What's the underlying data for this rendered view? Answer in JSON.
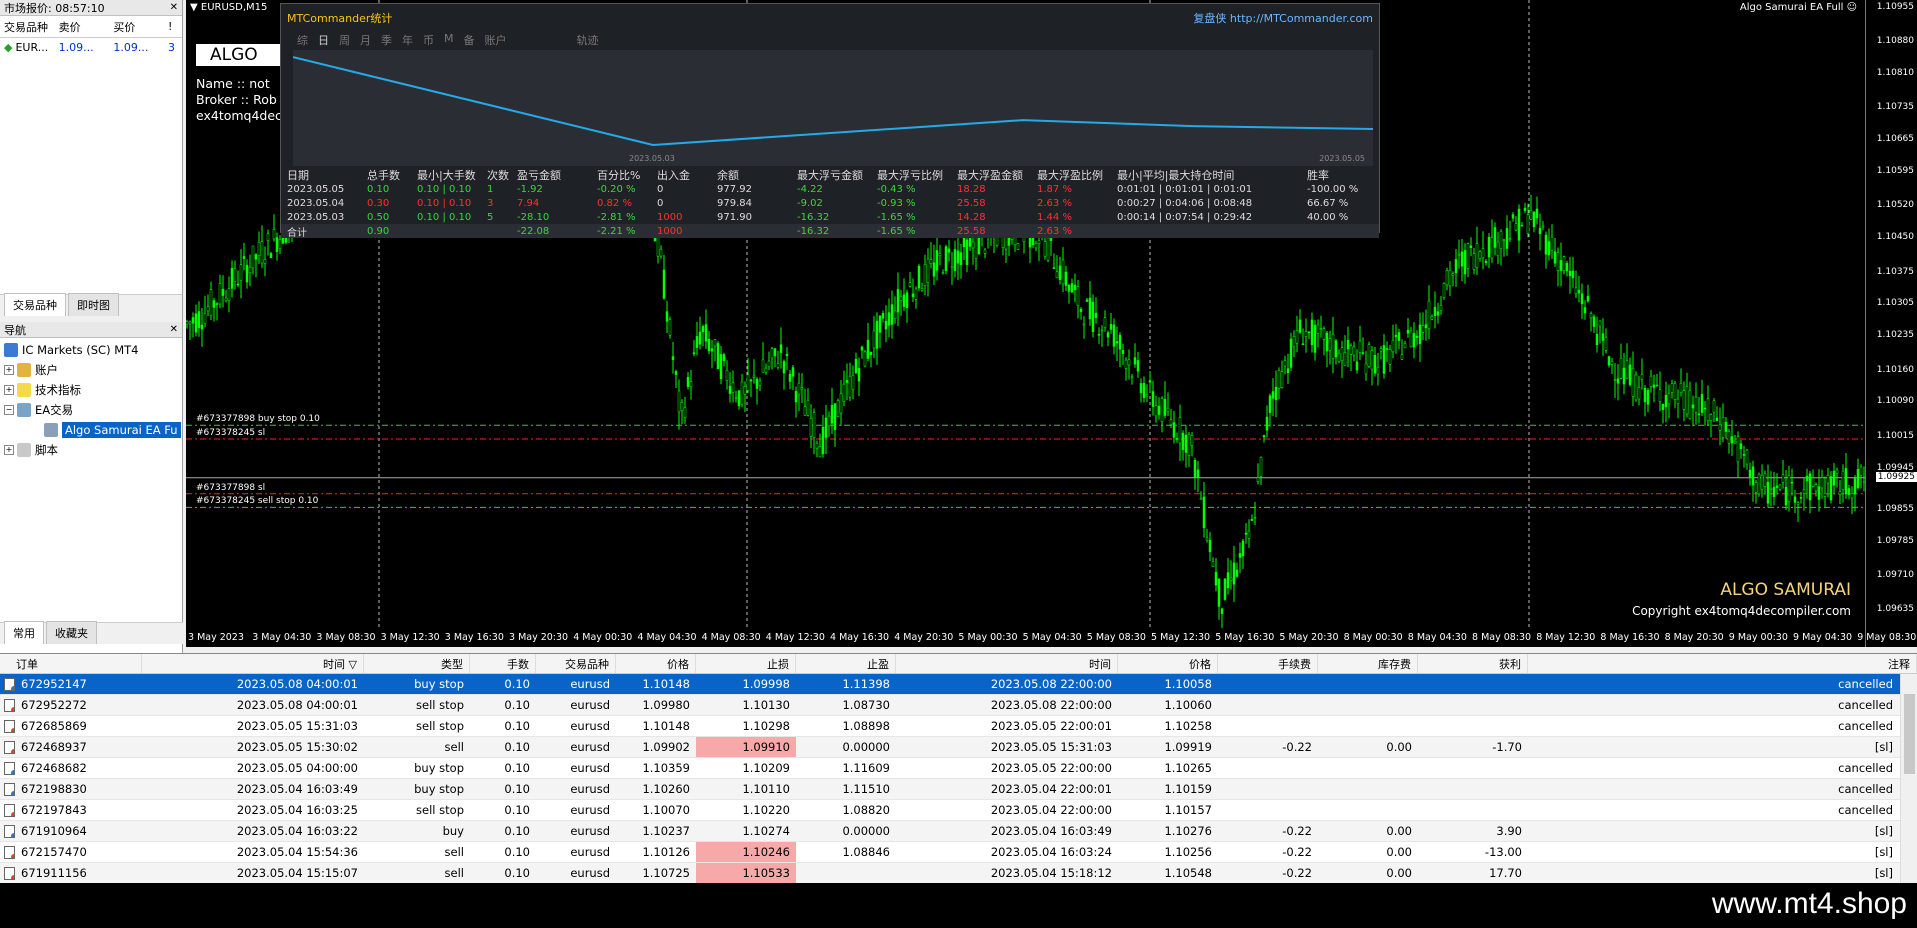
{
  "market_watch": {
    "title": "市场报价: 08:57:10",
    "headers": [
      "交易品种",
      "卖价",
      "买价",
      "!"
    ],
    "rows": [
      {
        "symbol": "EUR...",
        "bid": "1.09...",
        "ask": "1.09...",
        "spread": "3"
      }
    ],
    "tabs": [
      "交易品种",
      "即时图"
    ]
  },
  "navigator": {
    "title": "导航",
    "items": [
      "IC Markets (SC) MT4",
      "账户",
      "技术指标",
      "EA交易",
      "Algo Samurai EA Fu",
      "脚本"
    ],
    "tabs": [
      "常用",
      "收藏夹"
    ]
  },
  "chart": {
    "symbol": "EURUSD,M15",
    "ea_name": "Algo Samurai EA Full",
    "smiley": "☺",
    "algo_box": "ALGO",
    "algo_box_tail": "",
    "info_lines": [
      "Name :: not",
      "Broker :: Rob",
      "ex4tomq4dec"
    ],
    "brand": "ALGO SAMURAI",
    "copyright": "Copyright  ex4tomq4decompiler.com",
    "price_ticks": [
      "1.10955",
      "1.10880",
      "1.10810",
      "1.10735",
      "1.10665",
      "1.10595",
      "1.10520",
      "1.10450",
      "1.10375",
      "1.10305",
      "1.10235",
      "1.10160",
      "1.10090",
      "1.10015",
      "1.09945",
      "1.09855",
      "1.09785",
      "1.09710",
      "1.09635"
    ],
    "current_price": "1.09925",
    "time_ticks": [
      "3 May 2023",
      "3 May 04:30",
      "3 May 08:30",
      "3 May 12:30",
      "3 May 16:30",
      "3 May 20:30",
      "4 May 00:30",
      "4 May 04:30",
      "4 May 08:30",
      "4 May 12:30",
      "4 May 16:30",
      "4 May 20:30",
      "5 May 00:30",
      "5 May 04:30",
      "5 May 08:30",
      "5 May 12:30",
      "5 May 16:30",
      "5 May 20:30",
      "8 May 00:30",
      "8 May 04:30",
      "8 May 08:30",
      "8 May 12:30",
      "8 May 16:30",
      "8 May 20:30",
      "9 May 00:30",
      "9 May 04:30",
      "9 May 08:30"
    ],
    "order_labels": [
      {
        "text": "#673377898 buy stop 0.10",
        "price": 1.1004
      },
      {
        "text": "#673378245 sl",
        "price": 1.1001
      },
      {
        "text": "#673377898 sl",
        "price": 1.0989
      },
      {
        "text": "#673378245 sell stop 0.10",
        "price": 1.0986
      }
    ],
    "colors": {
      "candle": "#00ff00",
      "buy_line": "#33cc33",
      "sl_line": "#ff2020",
      "price_line": "#aaaaaa"
    }
  },
  "mtc": {
    "title": "MTCommander统计",
    "link": "复盘侠 http://MTCommander.com",
    "tabs": [
      "综",
      "日",
      "周",
      "月",
      "季",
      "年",
      "币",
      "M",
      "备",
      "账户",
      "轨迹"
    ],
    "active_tab": "日",
    "date_start": "2023.05.03",
    "date_end": "2023.05.05",
    "headers": [
      "日期",
      "总手数",
      "最小|大手数",
      "次数",
      "盈亏金额",
      "百分比%",
      "出入金",
      "余额",
      "最大浮亏金额",
      "最大浮亏比例",
      "最大浮盈金额",
      "最大浮盈比例",
      "最小|平均|最大持仓时间",
      "胜率"
    ],
    "rows": [
      [
        "2023.05.05",
        "0.10",
        "0.10 | 0.10",
        "1",
        "-1.92",
        "-0.20 %",
        "0",
        "977.92",
        "-4.22",
        "-0.43 %",
        "18.28",
        "1.87 %",
        "0:01:01 | 0:01:01 | 0:01:01",
        "-100.00 %"
      ],
      [
        "2023.05.04",
        "0.30",
        "0.10 | 0.10",
        "3",
        "7.94",
        "0.82 %",
        "0",
        "979.84",
        "-9.02",
        "-0.93 %",
        "25.58",
        "2.63 %",
        "0:00:27 | 0:04:06 | 0:08:48",
        "66.67 %"
      ],
      [
        "2023.05.03",
        "0.50",
        "0.10 | 0.10",
        "5",
        "-28.10",
        "-2.81 %",
        "1000",
        "971.90",
        "-16.32",
        "-1.65 %",
        "14.28",
        "1.44 %",
        "0:00:14 | 0:07:54 | 0:29:42",
        "40.00 %"
      ]
    ],
    "total": [
      "合计",
      "0.90",
      "",
      "",
      "-22.08",
      "-2.21 %",
      "1000",
      "",
      "-16.32",
      "-1.65 %",
      "25.58",
      "2.63 %",
      "",
      ""
    ],
    "balance_curve": [
      1000,
      971.9,
      979.84,
      977.92,
      977.0
    ]
  },
  "terminal": {
    "headers": [
      "订单",
      "时间",
      "类型",
      "手数",
      "交易品种",
      "价格",
      "止损",
      "止盈",
      "时间",
      "价格",
      "手续费",
      "库存费",
      "获利",
      "注释"
    ],
    "sort_mark": "▽",
    "rows": [
      {
        "order": "672952147",
        "time": "2023.05.08 04:00:01",
        "type": "buy stop",
        "lots": "0.10",
        "symbol": "eurusd",
        "price": "1.10148",
        "sl": "1.09998",
        "tp": "1.11398",
        "ctime": "2023.05.08 22:00:00",
        "cprice": "1.10058",
        "comm": "",
        "swap": "",
        "profit": "",
        "comment": "cancelled",
        "sl_hl": false
      },
      {
        "order": "672952272",
        "time": "2023.05.08 04:00:01",
        "type": "sell stop",
        "lots": "0.10",
        "symbol": "eurusd",
        "price": "1.09980",
        "sl": "1.10130",
        "tp": "1.08730",
        "ctime": "2023.05.08 22:00:00",
        "cprice": "1.10060",
        "comm": "",
        "swap": "",
        "profit": "",
        "comment": "cancelled",
        "sl_hl": false
      },
      {
        "order": "672685869",
        "time": "2023.05.05 15:31:03",
        "type": "sell stop",
        "lots": "0.10",
        "symbol": "eurusd",
        "price": "1.10148",
        "sl": "1.10298",
        "tp": "1.08898",
        "ctime": "2023.05.05 22:00:01",
        "cprice": "1.10258",
        "comm": "",
        "swap": "",
        "profit": "",
        "comment": "cancelled",
        "sl_hl": false
      },
      {
        "order": "672468937",
        "time": "2023.05.05 15:30:02",
        "type": "sell",
        "lots": "0.10",
        "symbol": "eurusd",
        "price": "1.09902",
        "sl": "1.09910",
        "tp": "0.00000",
        "ctime": "2023.05.05 15:31:03",
        "cprice": "1.09919",
        "comm": "-0.22",
        "swap": "0.00",
        "profit": "-1.70",
        "comment": "[sl]",
        "sl_hl": true
      },
      {
        "order": "672468682",
        "time": "2023.05.05 04:00:00",
        "type": "buy stop",
        "lots": "0.10",
        "symbol": "eurusd",
        "price": "1.10359",
        "sl": "1.10209",
        "tp": "1.11609",
        "ctime": "2023.05.05 22:00:00",
        "cprice": "1.10265",
        "comm": "",
        "swap": "",
        "profit": "",
        "comment": "cancelled",
        "sl_hl": false
      },
      {
        "order": "672198830",
        "time": "2023.05.04 16:03:49",
        "type": "buy stop",
        "lots": "0.10",
        "symbol": "eurusd",
        "price": "1.10260",
        "sl": "1.10110",
        "tp": "1.11510",
        "ctime": "2023.05.04 22:00:01",
        "cprice": "1.10159",
        "comm": "",
        "swap": "",
        "profit": "",
        "comment": "cancelled",
        "sl_hl": false
      },
      {
        "order": "672197843",
        "time": "2023.05.04 16:03:25",
        "type": "sell stop",
        "lots": "0.10",
        "symbol": "eurusd",
        "price": "1.10070",
        "sl": "1.10220",
        "tp": "1.08820",
        "ctime": "2023.05.04 22:00:00",
        "cprice": "1.10157",
        "comm": "",
        "swap": "",
        "profit": "",
        "comment": "cancelled",
        "sl_hl": false
      },
      {
        "order": "671910964",
        "time": "2023.05.04 16:03:22",
        "type": "buy",
        "lots": "0.10",
        "symbol": "eurusd",
        "price": "1.10237",
        "sl": "1.10274",
        "tp": "0.00000",
        "ctime": "2023.05.04 16:03:49",
        "cprice": "1.10276",
        "comm": "-0.22",
        "swap": "0.00",
        "profit": "3.90",
        "comment": "[sl]",
        "sl_hl": false
      },
      {
        "order": "672157470",
        "time": "2023.05.04 15:54:36",
        "type": "sell",
        "lots": "0.10",
        "symbol": "eurusd",
        "price": "1.10126",
        "sl": "1.10246",
        "tp": "1.08846",
        "ctime": "2023.05.04 16:03:24",
        "cprice": "1.10256",
        "comm": "-0.22",
        "swap": "0.00",
        "profit": "-13.00",
        "comment": "[sl]",
        "sl_hl": true
      },
      {
        "order": "671911156",
        "time": "2023.05.04 15:15:07",
        "type": "sell",
        "lots": "0.10",
        "symbol": "eurusd",
        "price": "1.10725",
        "sl": "1.10533",
        "tp": "",
        "ctime": "2023.05.04 15:18:12",
        "cprice": "1.10548",
        "comm": "-0.22",
        "swap": "0.00",
        "profit": "17.70",
        "comment": "[sl]",
        "sl_hl": true
      }
    ]
  },
  "watermark": "www.mt4.shop"
}
